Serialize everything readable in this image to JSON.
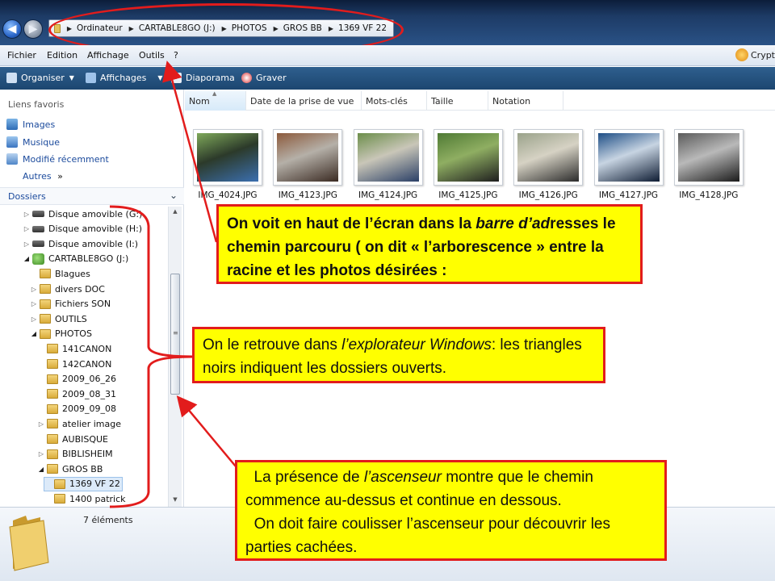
{
  "address_bar": {
    "crumbs": [
      "Ordinateur",
      "CARTABLE8GO (J:)",
      "PHOTOS",
      "GROS BB",
      "1369 VF 22"
    ]
  },
  "menubar": {
    "items": [
      "Fichier",
      "Edition",
      "Affichage",
      "Outils",
      "?"
    ],
    "crypt_label": "Crypt"
  },
  "toolbar": {
    "organiser": "Organiser",
    "affichages": "Affichages",
    "diaporama": "Diaporama",
    "graver": "Graver"
  },
  "favorites": {
    "heading": "Liens favoris",
    "items": [
      "Images",
      "Musique",
      "Modifié récemment"
    ],
    "more": "Autres",
    "more_arrows": "»"
  },
  "folders": {
    "heading": "Dossiers",
    "tree": [
      {
        "label": "Disque amovible (G:)",
        "type": "drive",
        "state": "closed"
      },
      {
        "label": "Disque amovible (H:)",
        "type": "drive",
        "state": "closed"
      },
      {
        "label": "Disque amovible (I:)",
        "type": "drive",
        "state": "closed"
      },
      {
        "label": "CARTABLE8GO (J:)",
        "type": "usb",
        "state": "open"
      },
      {
        "label": "Blagues",
        "type": "folder",
        "state": "none"
      },
      {
        "label": "divers DOC",
        "type": "folder",
        "state": "closed"
      },
      {
        "label": "Fichiers SON",
        "type": "folder",
        "state": "closed"
      },
      {
        "label": "OUTILS",
        "type": "folder",
        "state": "closed"
      },
      {
        "label": "PHOTOS",
        "type": "folder",
        "state": "open"
      },
      {
        "label": "141CANON",
        "type": "folder",
        "state": "none"
      },
      {
        "label": "142CANON",
        "type": "folder",
        "state": "none"
      },
      {
        "label": "2009_06_26",
        "type": "folder",
        "state": "none"
      },
      {
        "label": "2009_08_31",
        "type": "folder",
        "state": "none"
      },
      {
        "label": "2009_09_08",
        "type": "folder",
        "state": "none"
      },
      {
        "label": "atelier image",
        "type": "folder",
        "state": "closed"
      },
      {
        "label": "AUBISQUE",
        "type": "folder",
        "state": "none"
      },
      {
        "label": "BIBLISHEIM",
        "type": "folder",
        "state": "closed"
      },
      {
        "label": "GROS BB",
        "type": "folder",
        "state": "open"
      },
      {
        "label": "1369 VF 22",
        "type": "folder",
        "state": "none",
        "selected": true
      },
      {
        "label": "1400 patrick",
        "type": "folder",
        "state": "none"
      }
    ]
  },
  "columns": [
    "Nom",
    "Date de la prise de vue",
    "Mots-clés",
    "Taille",
    "Notation"
  ],
  "files": [
    {
      "name": "IMG_4024.JPG",
      "colors": [
        "#7fa95a",
        "#3b6fb0",
        "#2c3a2a"
      ]
    },
    {
      "name": "IMG_4123.JPG",
      "colors": [
        "#8c5a3c",
        "#3a2a22",
        "#b5b0a8"
      ]
    },
    {
      "name": "IMG_4124.JPG",
      "colors": [
        "#6c8e4a",
        "#2a3f66",
        "#c9c6b8"
      ]
    },
    {
      "name": "IMG_4125.JPG",
      "colors": [
        "#4f7a34",
        "#1e1e1e",
        "#8fae62"
      ]
    },
    {
      "name": "IMG_4126.JPG",
      "colors": [
        "#9aa28a",
        "#2b2b2b",
        "#d6d2c4"
      ]
    },
    {
      "name": "IMG_4127.JPG",
      "colors": [
        "#1e4e86",
        "#0e1c33",
        "#c7d4e2"
      ]
    },
    {
      "name": "IMG_4128.JPG",
      "colors": [
        "#5b5b5b",
        "#1b1b1b",
        "#b9b9b9"
      ]
    }
  ],
  "status": {
    "count_text": "7 éléments"
  },
  "annotations": {
    "callout1_parts": [
      "On voit en haut de l’écran dans la ",
      "barre d’ad",
      "resses le chemin parcouru ( on dit « l’arborescence » entre la racine et les photos désirées :"
    ],
    "callout2_parts": [
      "On le retrouve dans ",
      "l’explorateur Windows",
      ": les triangles noirs indiquent les dossiers ouverts."
    ],
    "callout3_parts": [
      "  La présence de ",
      "l’ascenseur",
      " montre que le chemin commence au-dessus et continue en dessous.",
      "  On doit faire coulisser l’ascenseur pour découvrir les parties cachées."
    ],
    "accent_color": "#e21c1c",
    "highlight_color": "#ffff00"
  }
}
